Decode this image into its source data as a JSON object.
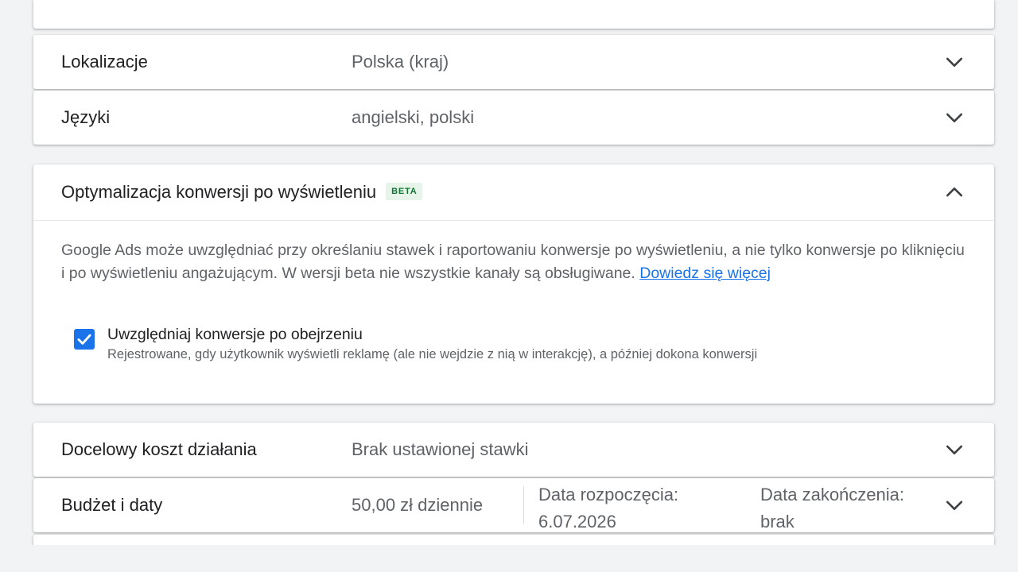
{
  "colors": {
    "background": "#f1f3f4",
    "accent": "#1a73e8",
    "beta_bg": "#e6f4ea",
    "beta_text": "#137333"
  },
  "rows": {
    "locations": {
      "label": "Lokalizacje",
      "value": "Polska (kraj)",
      "icon": "chevron-down-icon"
    },
    "languages": {
      "label": "Języki",
      "value": "angielski, polski",
      "icon": "chevron-down-icon"
    },
    "target_cpa": {
      "label": "Docelowy koszt działania",
      "value": "Brak ustawionej stawki",
      "icon": "chevron-down-icon"
    },
    "budget": {
      "label": "Budżet i daty",
      "value": "50,00 zł dziennie",
      "start_label": "Data rozpoczęcia:",
      "start_value": "6.07.2026",
      "end_label": "Data zakończenia:",
      "end_value": "brak",
      "icon": "chevron-down-icon"
    }
  },
  "view_through": {
    "title": "Optymalizacja konwersji po wyświetleniu",
    "badge": "BETA",
    "icon": "chevron-up-icon",
    "description": "Google Ads może uwzględniać przy określaniu stawek i raportowaniu konwersje po wyświetleniu, a nie tylko konwersje po kliknięciu i po wyświetleniu angażującym. W wersji beta nie wszystkie kanały są obsługiwane.",
    "learn_more": "Dowiedz się więcej",
    "checkbox": {
      "checked": true,
      "label": "Uwzględniaj konwersje po obejrzeniu",
      "sublabel": "Rejestrowane, gdy użytkownik wyświetli reklamę (ale nie wejdzie z nią w interakcję), a później dokona konwersji",
      "icon": "check-icon"
    }
  }
}
